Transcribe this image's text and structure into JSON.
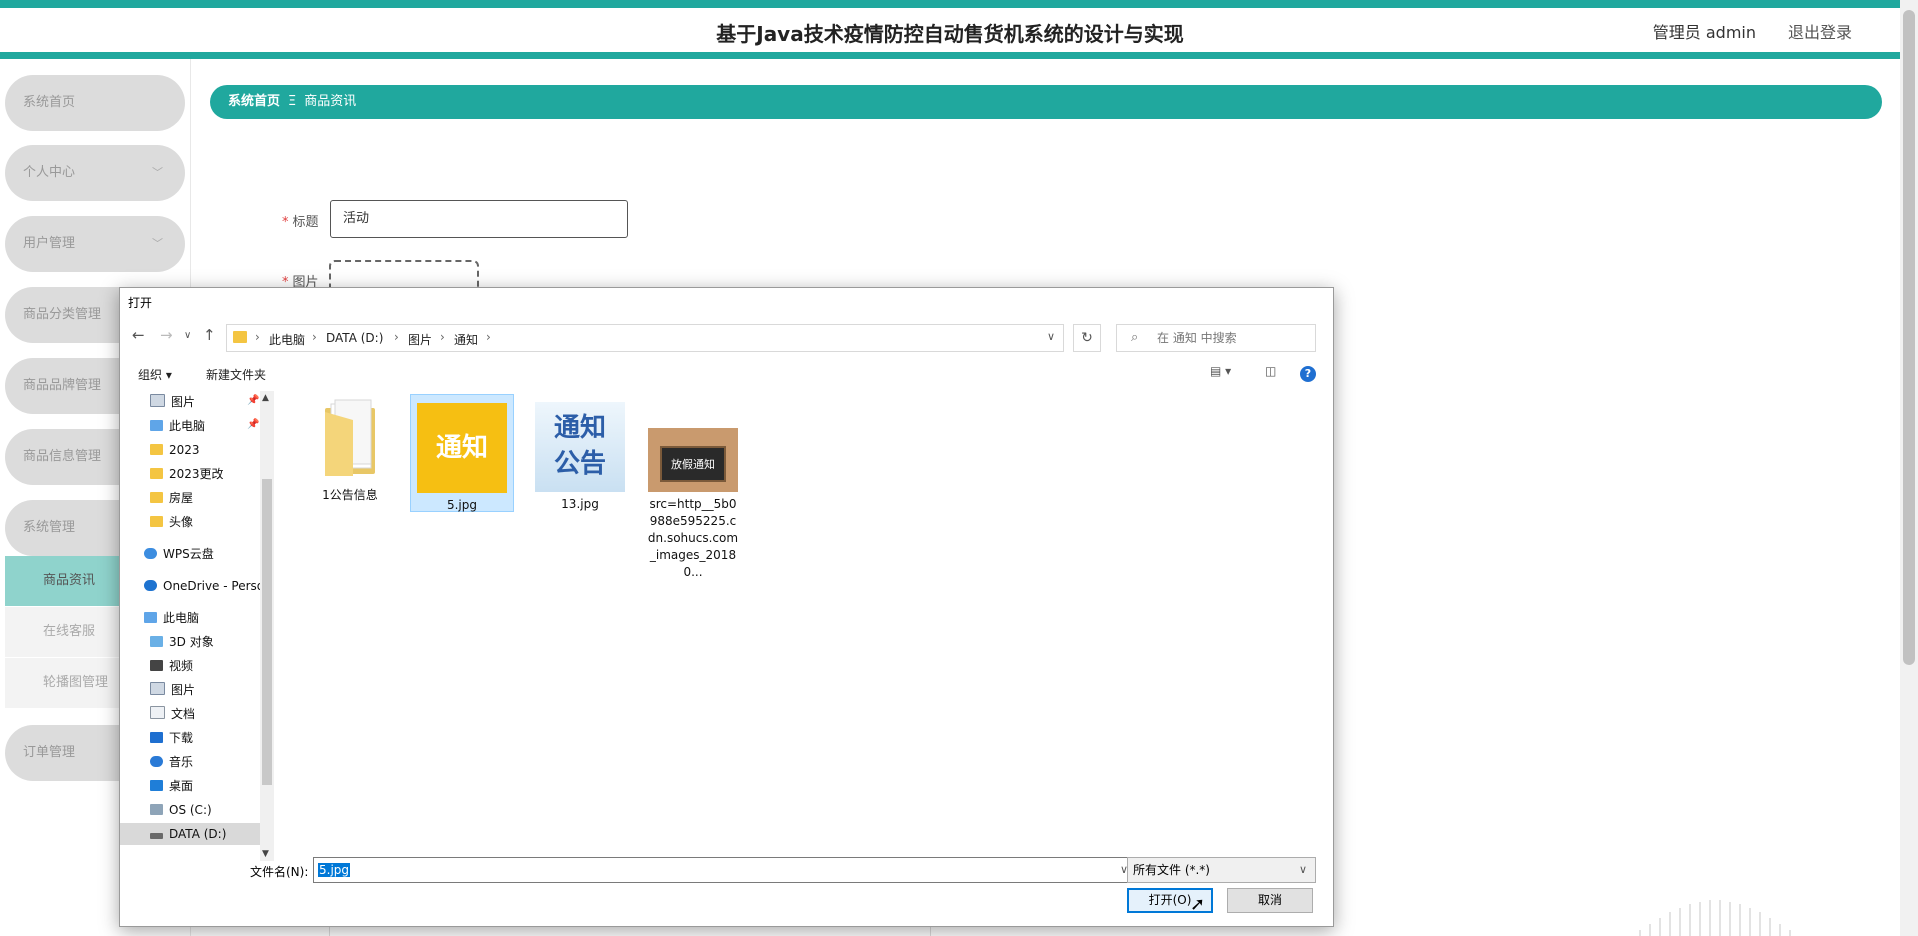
{
  "header": {
    "title": "基于Java技术疫情防控自动售货机系统的设计与实现",
    "user": "管理员 admin",
    "logout": "退出登录"
  },
  "sidebar": {
    "items": [
      {
        "label": "系统首页"
      },
      {
        "label": "个人中心"
      },
      {
        "label": "用户管理"
      },
      {
        "label": "商品分类管理"
      },
      {
        "label": "商品品牌管理"
      },
      {
        "label": "商品信息管理"
      },
      {
        "label": "系统管理"
      },
      {
        "label": "订单管理"
      }
    ],
    "subitems": [
      {
        "label": "商品资讯"
      },
      {
        "label": "在线客服"
      },
      {
        "label": "轮播图管理"
      }
    ]
  },
  "breadcrumb": {
    "home": "系统首页",
    "sep": "Ξ",
    "current": "商品资讯"
  },
  "form": {
    "title_label": "标题",
    "title_value": "活动",
    "image_label": "图片",
    "required_mark": "*"
  },
  "dialog": {
    "title": "打开",
    "path": [
      "此电脑",
      "DATA (D:)",
      "图片",
      "通知"
    ],
    "search_placeholder": "在 通知 中搜索",
    "toolbar": {
      "organize": "组织 ▾",
      "new_folder": "新建文件夹"
    },
    "nav_items": [
      {
        "label": "图片",
        "icon": "pictures-icon",
        "pinned": true
      },
      {
        "label": "此电脑",
        "icon": "computer-icon",
        "pinned": true
      },
      {
        "label": "2023",
        "icon": "folder-icon"
      },
      {
        "label": "2023更改",
        "icon": "folder-icon"
      },
      {
        "label": "房屋",
        "icon": "folder-icon"
      },
      {
        "label": "头像",
        "icon": "folder-icon"
      },
      {
        "label": "WPS云盘",
        "icon": "cloud-icon"
      },
      {
        "label": "OneDrive - Perso",
        "icon": "cloud-icon"
      },
      {
        "label": "此电脑",
        "icon": "computer-icon"
      },
      {
        "label": "3D 对象",
        "icon": "3d-objects-icon"
      },
      {
        "label": "视频",
        "icon": "video-icon"
      },
      {
        "label": "图片",
        "icon": "pictures-icon"
      },
      {
        "label": "文档",
        "icon": "documents-icon"
      },
      {
        "label": "下载",
        "icon": "download-icon"
      },
      {
        "label": "音乐",
        "icon": "music-icon"
      },
      {
        "label": "桌面",
        "icon": "desktop-icon"
      },
      {
        "label": "OS (C:)",
        "icon": "drive-icon"
      },
      {
        "label": "DATA (D:)",
        "icon": "drive-icon",
        "selected": true
      }
    ],
    "files": [
      {
        "name": "1公告信息",
        "type": "folder"
      },
      {
        "name": "5.jpg",
        "type": "image",
        "thumb_text": "通知",
        "selected": true
      },
      {
        "name": "13.jpg",
        "type": "image",
        "thumb_text_1": "通知",
        "thumb_text_2": "公告"
      },
      {
        "name": "src=http__5b0988e595225.cdn.sohucs.com_images_20180...",
        "type": "image",
        "thumb_text": "放假通知"
      }
    ],
    "filename_label": "文件名(N):",
    "filename_value": "5.jpg",
    "filetype": "所有文件 (*.*)",
    "open_button": "打开(O)",
    "cancel_button": "取消"
  },
  "colors": {
    "accent": "#20a89e",
    "sidebar_item": "#dcdcdc",
    "active_sub": "#8fd3cc",
    "win_blue": "#0078d7"
  }
}
